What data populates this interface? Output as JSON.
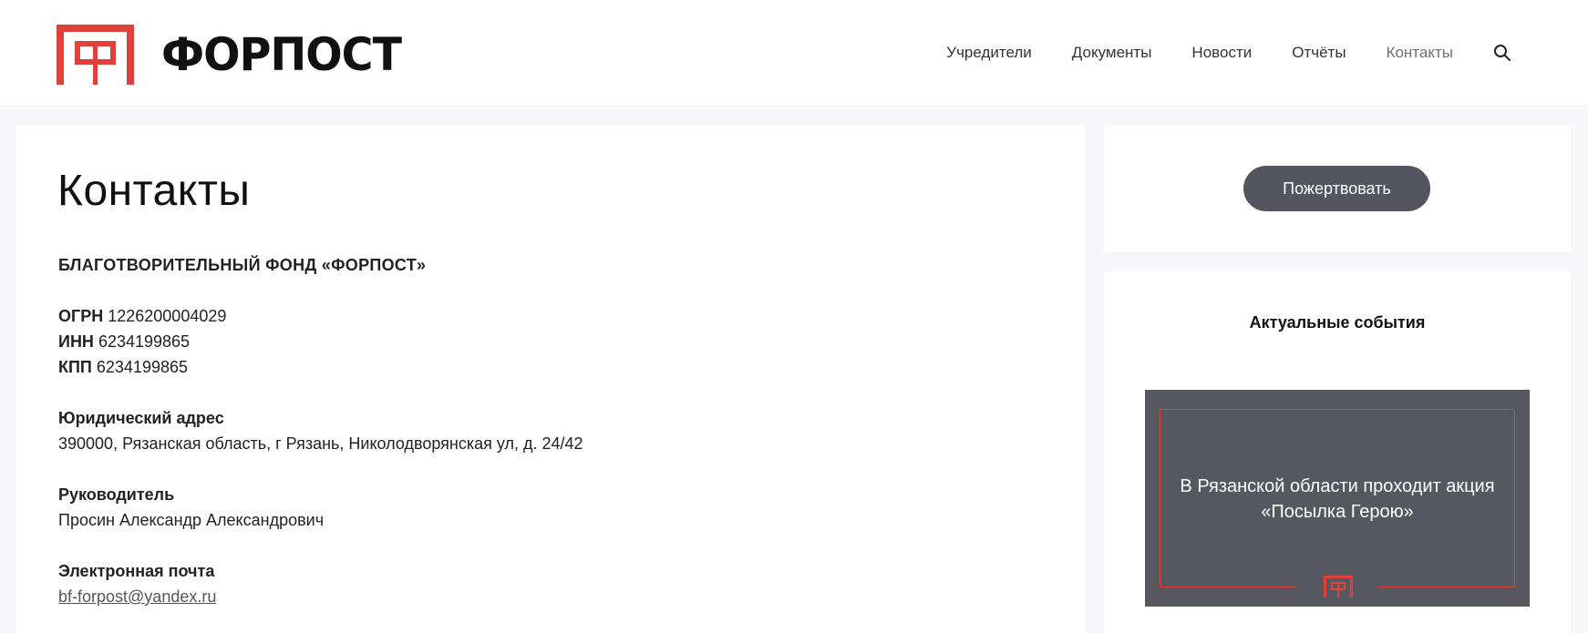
{
  "site": {
    "logo_text": "ФОРПОСТ",
    "brand_color": "#e0413a"
  },
  "nav": {
    "items": [
      {
        "label": "Учредители"
      },
      {
        "label": "Документы"
      },
      {
        "label": "Новости"
      },
      {
        "label": "Отчёты"
      },
      {
        "label": "Контакты",
        "active": true
      }
    ],
    "search_icon": "search-icon"
  },
  "page": {
    "title": "Контакты",
    "org_name": "БЛАГОТВОРИТЕЛЬНЫЙ ФОНД «ФОРПОСТ»",
    "ogrn_label": "ОГРН",
    "ogrn_value": "1226200004029",
    "inn_label": "ИНН",
    "inn_value": "6234199865",
    "kpp_label": "КПП",
    "kpp_value": "6234199865",
    "address_label": "Юридический адрес",
    "address_value": "390000, Рязанская область, г Рязань, Николодворянская ул, д. 24/42",
    "head_label": "Руководитель",
    "head_value": "Просин Александр Александрович",
    "email_label": "Электронная почта",
    "email_value": "bf-forpost@yandex.ru"
  },
  "sidebar": {
    "donate_label": "Пожертвовать",
    "events_title": "Актуальные события",
    "event_text": "В Рязанской области проходит акция «Посылка Герою»",
    "event_bg": "#575760"
  }
}
